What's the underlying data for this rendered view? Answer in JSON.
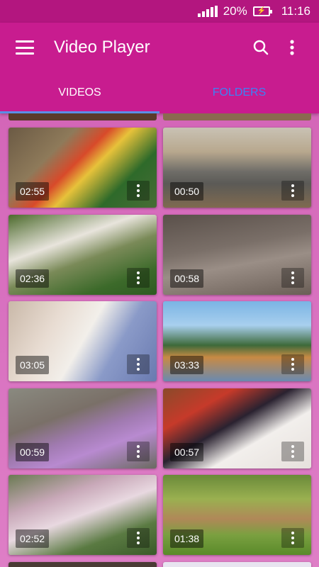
{
  "status_bar": {
    "battery_percent": "20%",
    "time": "11:16"
  },
  "app_bar": {
    "title": "Video Player",
    "menu_icon": "hamburger-menu-icon",
    "search_icon": "search-icon",
    "overflow_icon": "overflow-menu-icon"
  },
  "tabs": [
    {
      "label": "VIDEOS",
      "selected": true
    },
    {
      "label": "FOLDERS",
      "selected": false
    }
  ],
  "colors": {
    "status_bar": "#b3167f",
    "app_bar": "#c81c8f",
    "folders_tab_text": "#3b82f6",
    "indicator": "#5b8fe6",
    "background": "#d870bf"
  },
  "videos": [
    {
      "duration": "02:55"
    },
    {
      "duration": "00:50"
    },
    {
      "duration": "02:36"
    },
    {
      "duration": "00:58"
    },
    {
      "duration": "03:05"
    },
    {
      "duration": "03:33"
    },
    {
      "duration": "00:59"
    },
    {
      "duration": "00:57"
    },
    {
      "duration": "02:52"
    },
    {
      "duration": "01:38"
    }
  ]
}
